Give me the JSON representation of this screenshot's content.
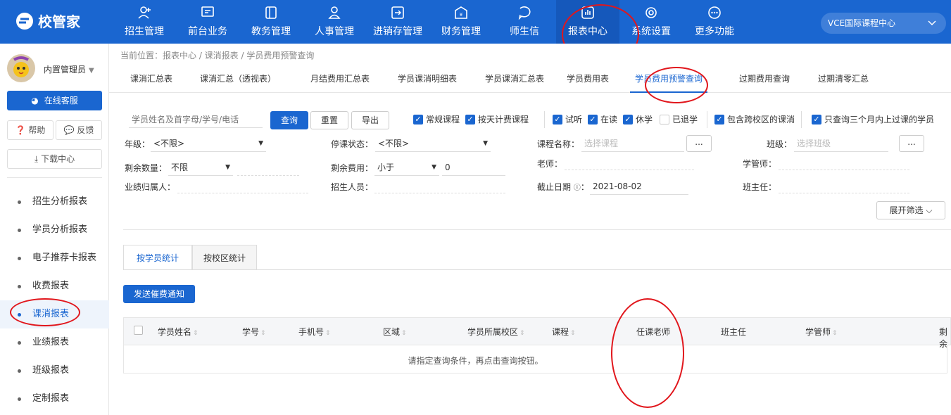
{
  "app": {
    "logo_text": "校管家",
    "campus": "VCE国际课程中心"
  },
  "nav": [
    {
      "label": "招生管理",
      "icon": "person-add-icon"
    },
    {
      "label": "前台业务",
      "icon": "monitor-icon"
    },
    {
      "label": "教务管理",
      "icon": "book-icon"
    },
    {
      "label": "人事管理",
      "icon": "person-icon"
    },
    {
      "label": "进销存管理",
      "icon": "box-in-icon"
    },
    {
      "label": "财务管理",
      "icon": "finance-icon"
    },
    {
      "label": "师生信",
      "icon": "chat-icon"
    },
    {
      "label": "报表中心",
      "icon": "chart-icon"
    },
    {
      "label": "系统设置",
      "icon": "gear-icon"
    },
    {
      "label": "更多功能",
      "icon": "more-icon"
    }
  ],
  "sidebar": {
    "user": "内置管理员",
    "service": "在线客服",
    "help": "帮助",
    "feedback": "反馈",
    "download": "下载中心",
    "menu": [
      "招生分析报表",
      "学员分析报表",
      "电子推荐卡报表",
      "收费报表",
      "课消报表",
      "业绩报表",
      "班级报表",
      "定制报表"
    ]
  },
  "breadcrumb": "当前位置：报表中心 / 课消报表 / 学员费用预警查询",
  "tabs": [
    "课消汇总表",
    "课消汇总（透视表）",
    "月结费用汇总表",
    "学员课消明细表",
    "学员课消汇总表",
    "学员费用表",
    "学员费用预警查询",
    "过期费用查询",
    "过期清零汇总"
  ],
  "filters": {
    "search_placeholder": "学员姓名及首字母/学号/电话",
    "query": "查询",
    "reset": "重置",
    "export": "导出",
    "checks": [
      {
        "label": "常规课程",
        "checked": true
      },
      {
        "label": "按天计费课程",
        "checked": true
      },
      {
        "label": "试听",
        "checked": true
      },
      {
        "label": "在读",
        "checked": true
      },
      {
        "label": "休学",
        "checked": true
      },
      {
        "label": "已退学",
        "checked": false
      },
      {
        "label": "包含跨校区的课消",
        "checked": true
      },
      {
        "label": "只查询三个月内上过课的学员",
        "checked": true
      }
    ],
    "grade_label": "年级：",
    "grade_value": "<不限>",
    "pause_label": "停课状态：",
    "pause_value": "<不限>",
    "course_label": "课程名称：",
    "course_placeholder": "选择课程",
    "class_label": "班级：",
    "class_placeholder": "选择班级",
    "remain_qty_label": "剩余数量：",
    "remain_qty_value": "不限",
    "remain_fee_label": "剩余费用：",
    "remain_fee_op": "小于",
    "remain_fee_value": "0",
    "teacher_label": "老师：",
    "manager_label": "学管师：",
    "perf_label": "业绩归属人：",
    "recruiter_label": "招生人员：",
    "deadline_label": "截止日期",
    "deadline_value": "2021-08-02",
    "headteacher_label": "班主任：",
    "expand": "展开筛选",
    "dots": "..."
  },
  "subtabs": [
    "按学员统计",
    "按校区统计"
  ],
  "notify_btn": "发送催费通知",
  "table": {
    "headers": [
      "学员姓名",
      "学号",
      "手机号",
      "区域",
      "学员所属校区",
      "课程",
      "任课老师",
      "班主任",
      "学管师",
      "剩余"
    ],
    "empty": "请指定查询条件，再点击查询按钮。"
  }
}
